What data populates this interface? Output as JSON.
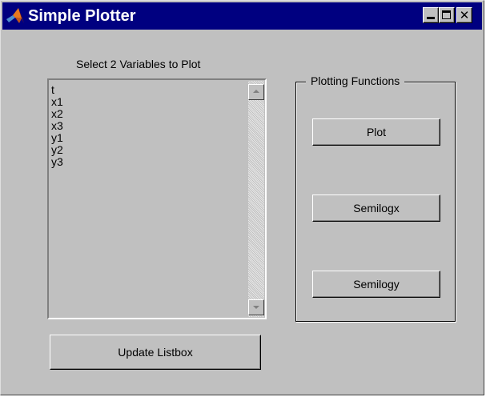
{
  "window": {
    "title": "Simple Plotter",
    "controls": {
      "minimize": "minimize",
      "maximize": "maximize",
      "close": "close"
    }
  },
  "listbox": {
    "label": "Select 2 Variables to Plot",
    "items": [
      "t",
      "x1",
      "x2",
      "x3",
      "y1",
      "y2",
      "y3"
    ]
  },
  "plotting_functions": {
    "legend": "Plotting Functions",
    "buttons": {
      "plot": "Plot",
      "semilogx": "Semilogx",
      "semilogy": "Semilogy"
    }
  },
  "update_button": "Update Listbox",
  "icons": {
    "app": "matlab-logo-icon",
    "minimize": "minimize-icon",
    "maximize": "maximize-icon",
    "close": "close-icon",
    "scroll_up": "scroll-up-arrow-icon",
    "scroll_down": "scroll-down-arrow-icon"
  },
  "colors": {
    "titlebar": "#000080",
    "face": "#c0c0c0",
    "logo_orange": "#e8781e",
    "logo_dark": "#8a2a10"
  }
}
